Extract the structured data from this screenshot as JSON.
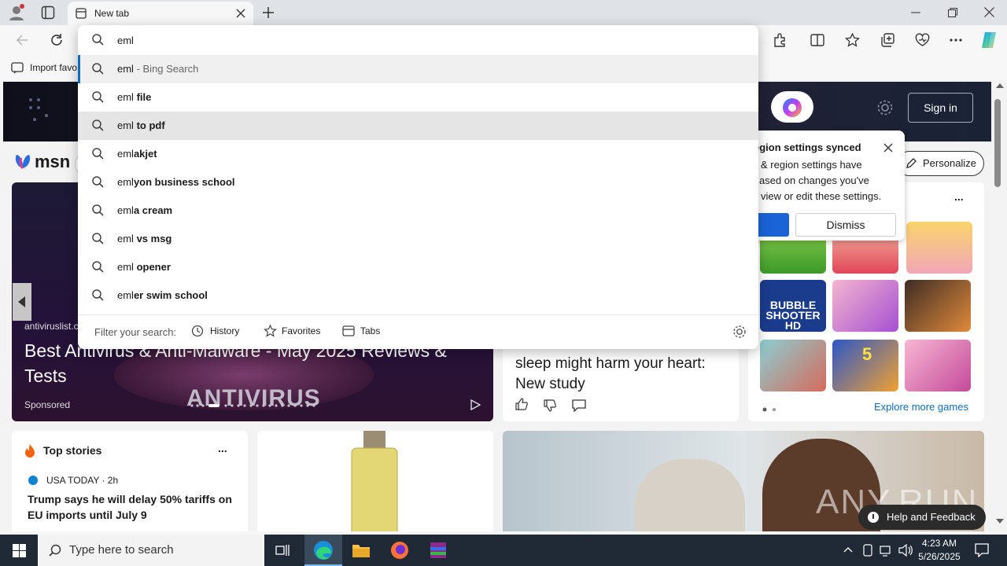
{
  "browser": {
    "tab_title": "New tab",
    "address_value": "eml",
    "favorites_bar_item": "Import favo"
  },
  "suggestions": [
    {
      "prefix": "eml",
      "suffix": "",
      "muted": " - Bing Search"
    },
    {
      "prefix": "eml",
      "suffix": " file",
      "muted": ""
    },
    {
      "prefix": "eml",
      "suffix": " to pdf",
      "muted": ""
    },
    {
      "prefix": "eml",
      "suffix": "akjet",
      "muted": ""
    },
    {
      "prefix": "eml",
      "suffix": "yon business school",
      "muted": ""
    },
    {
      "prefix": "eml",
      "suffix": "a cream",
      "muted": ""
    },
    {
      "prefix": "eml",
      "suffix": " vs msg",
      "muted": ""
    },
    {
      "prefix": "eml",
      "suffix": " opener",
      "muted": ""
    },
    {
      "prefix": "eml",
      "suffix": "er swim school",
      "muted": ""
    }
  ],
  "filter": {
    "label": "Filter your search:",
    "history": "History",
    "favorites": "Favorites",
    "tabs": "Tabs"
  },
  "page": {
    "sign_in": "Sign in",
    "msn_logo": "msn",
    "personalize": "Personalize",
    "toast_title": "egion settings synced",
    "toast_line1": "& region settings have",
    "toast_line2": "ased on changes you've",
    "toast_line3": "view or edit these settings.",
    "toast_dismiss": "Dismiss",
    "ad_source": "antiviruslist.co",
    "ad_title": "Best Antivirus & Anti-Malware - May 2025 Reviews & Tests",
    "ad_sponsored": "Sponsored",
    "ad_overlay": "ANTIVIRUS",
    "news_title": "sleep might harm your heart: New study",
    "news_title_partial": "...",
    "games_more": "...",
    "games": [
      "",
      "",
      "",
      "BUBBLE SHOOTER HD",
      "",
      "",
      "",
      "5",
      ""
    ],
    "explore_games": "Explore more games",
    "top_stories": "Top stories",
    "top_stories_more": "...",
    "story_source": "USA TODAY · 2h",
    "story_title": "Trump says he will delay 50% tariffs on EU imports until July 9",
    "help_feedback": "Help and Feedback",
    "watermark": "ANY.RUN"
  },
  "taskbar": {
    "search_placeholder": "Type here to search",
    "time": "4:23 AM",
    "date": "5/26/2025"
  },
  "colors": {
    "accent": "#0f6cbd",
    "selected_row": "#e5e5e5",
    "hover_row": "#f0f0f0",
    "taskbar": "#1f2a36",
    "titlebar": "#dfe3e8"
  }
}
